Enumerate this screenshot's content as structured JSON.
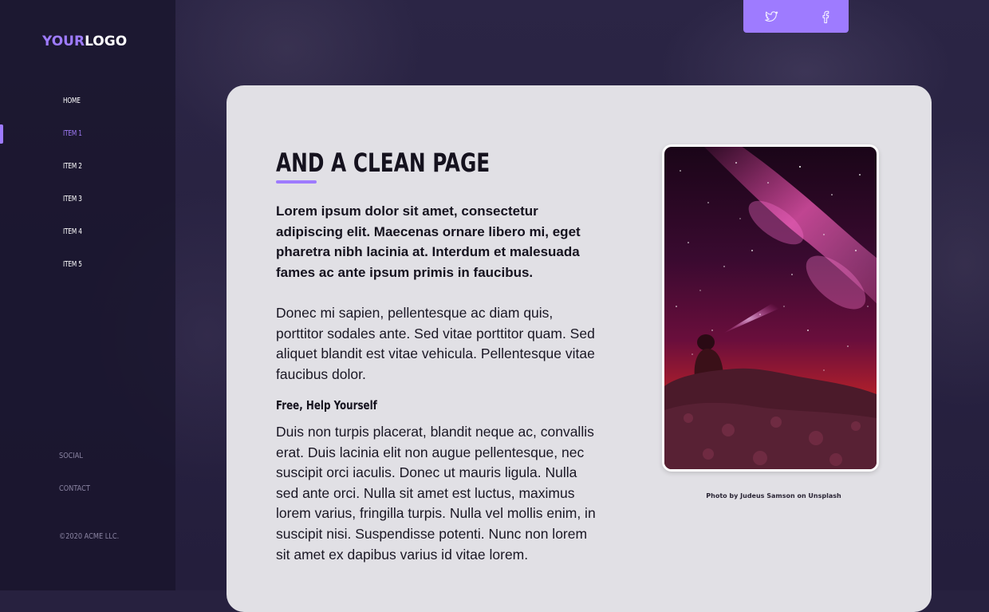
{
  "logo": {
    "part1": "YOUR",
    "part2": "LOGO"
  },
  "nav": {
    "items": [
      {
        "label": "HOME"
      },
      {
        "label": "ITEM 1"
      },
      {
        "label": "ITEM 2"
      },
      {
        "label": "ITEM 3"
      },
      {
        "label": "ITEM 4"
      },
      {
        "label": "ITEM 5"
      }
    ],
    "active_index": 1
  },
  "footer": {
    "social_label": "SOCIAL",
    "contact_label": "CONTACT",
    "copyright": "©2020 ACME LLC."
  },
  "social": {
    "icons": [
      "twitter-icon",
      "facebook-icon"
    ]
  },
  "content": {
    "title": "AND A CLEAN PAGE",
    "lead": "Lorem ipsum dolor sit amet, consectetur adipiscing elit. Maecenas ornare libero mi, eget pharetra nibh lacinia at. Interdum et malesuada fames ac ante ipsum primis in faucibus.",
    "paragraph1": "Donec mi sapien, pellentesque ac diam quis, porttitor sodales ante. Sed vitae porttitor quam. Sed aliquet blandit est vitae vehicula. Pellentesque vitae faucibus dolor.",
    "subheading": "Free, Help Yourself",
    "paragraph2": "Duis non turpis placerat, blandit neque ac, convallis erat. Duis lacinia elit non augue pellentesque, nec suscipit orci iaculis. Donec ut mauris ligula. Nulla sed ante orci. Nulla sit amet est luctus, maximus lorem varius, fringilla turpis. Nulla vel mollis enim, in suscipit nisi. Suspendisse potenti. Nunc non lorem sit amet ex dapibus varius id vitae lorem.",
    "photo_caption": "Photo by Judeus Samson on Unsplash"
  },
  "colors": {
    "accent": "#9e7bff",
    "background": "#27213f",
    "card": "#e1e0e5",
    "text": "#15121e"
  }
}
